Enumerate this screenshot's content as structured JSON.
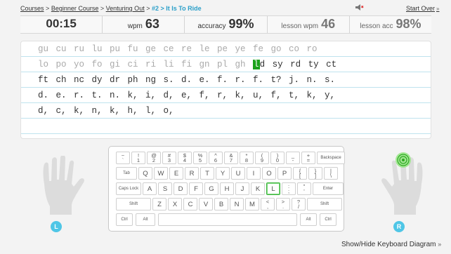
{
  "breadcrumb": {
    "items": [
      "Courses",
      "Beginner Course",
      "Venturing Out"
    ],
    "sep": ">",
    "current": "#2 > It Is To Ride"
  },
  "header": {
    "start_over": "Start Over",
    "start_over_chev": "»",
    "speaker_icon": "speaker-icon"
  },
  "stats": {
    "timer": "00:15",
    "wpm_label": "wpm",
    "wpm": "63",
    "accuracy_label": "accuracy",
    "accuracy": "99%",
    "lesson_wpm_label": "lesson wpm",
    "lesson_wpm": "46",
    "lesson_acc_label": "lesson acc",
    "lesson_acc": "98%"
  },
  "text": {
    "line1": "gu cu ru lu pu fu ge ce re le pe ye fe go co ro",
    "line2_before": "lo po yo fo gi ci ri li fi gn pl gh ",
    "line2_cursor": "l",
    "line2_after": "d sy rd ty ct",
    "line3": "ft ch nc dy dr ph ng s. d. e. f. r. f. t? j. n. s.",
    "line4": "d. e. r. t. n. k, i, d, e, f, r, k, u, f, t, k, y,",
    "line5": "d, c, k, n, k, h, l, o,"
  },
  "keyboard": {
    "row1": [
      [
        "~",
        "`"
      ],
      [
        "!",
        "1"
      ],
      [
        "@",
        "2"
      ],
      [
        "#",
        "3"
      ],
      [
        "$",
        "4"
      ],
      [
        "%",
        "5"
      ],
      [
        "^",
        "6"
      ],
      [
        "&",
        "7"
      ],
      [
        "*",
        "8"
      ],
      [
        "(",
        "9"
      ],
      [
        ")",
        "0"
      ],
      [
        "_",
        "-"
      ],
      [
        "+",
        "="
      ]
    ],
    "backspace": "Backspace",
    "tab": "Tab",
    "row2": [
      "Q",
      "W",
      "E",
      "R",
      "T",
      "Y",
      "U",
      "I",
      "O",
      "P"
    ],
    "row2_extra": [
      [
        "{",
        "["
      ],
      [
        "}",
        "]"
      ],
      [
        "|",
        "\\"
      ]
    ],
    "capslock": "Caps Lock",
    "row3": [
      "A",
      "S",
      "D",
      "F",
      "G",
      "H",
      "J",
      "K",
      "L"
    ],
    "row3_extra": [
      [
        ":",
        ";"
      ],
      [
        "\"",
        "'"
      ]
    ],
    "enter": "Enter",
    "shift": "Shift",
    "row4": [
      "Z",
      "X",
      "C",
      "V",
      "B",
      "N",
      "M"
    ],
    "row4_extra": [
      [
        "<",
        ","
      ],
      [
        ">",
        "."
      ],
      [
        "?",
        "/"
      ]
    ],
    "ctrl": "Ctrl",
    "alt": "Alt",
    "active_key": "L"
  },
  "hands": {
    "left_badge": "L",
    "right_badge": "R"
  },
  "footer": {
    "show_hide": "Show/Hide Keyboard Diagram",
    "chev": "»"
  },
  "colors": {
    "accent": "#4fc6e6",
    "active": "#1aa21a"
  }
}
